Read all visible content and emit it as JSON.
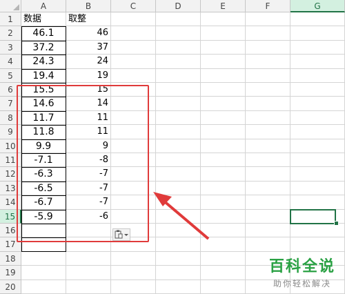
{
  "columns": [
    "A",
    "B",
    "C",
    "D",
    "E",
    "F",
    "G"
  ],
  "row_numbers": [
    "1",
    "2",
    "3",
    "4",
    "5",
    "6",
    "7",
    "8",
    "9",
    "10",
    "11",
    "12",
    "13",
    "14",
    "15",
    "16",
    "17",
    "18",
    "19",
    "20"
  ],
  "headers": {
    "a": "数据",
    "b": "取整"
  },
  "data_rows": [
    {
      "a": "46.1",
      "b": "46"
    },
    {
      "a": "37.2",
      "b": "37"
    },
    {
      "a": "24.3",
      "b": "24"
    },
    {
      "a": "19.4",
      "b": "19"
    },
    {
      "a": "15.5",
      "b": "15"
    },
    {
      "a": "14.6",
      "b": "14"
    },
    {
      "a": "11.7",
      "b": "11"
    },
    {
      "a": "11.8",
      "b": "11"
    },
    {
      "a": "9.9",
      "b": "9"
    },
    {
      "a": "-7.1",
      "b": "-8"
    },
    {
      "a": "-6.3",
      "b": "-7"
    },
    {
      "a": "-6.5",
      "b": "-7"
    },
    {
      "a": "-6.7",
      "b": "-7"
    },
    {
      "a": "-5.9",
      "b": "-6"
    }
  ],
  "selected_column": "G",
  "selected_row": "15",
  "colors": {
    "highlight_box": "#e03a3a",
    "arrow": "#e03a3a",
    "selection": "#217346",
    "watermark_green": "#2aa144"
  },
  "icons": {
    "paste_options": "clipboard-paste-options-icon"
  },
  "watermark": {
    "title": "百科全说",
    "subtitle": "助你轻松解决"
  }
}
